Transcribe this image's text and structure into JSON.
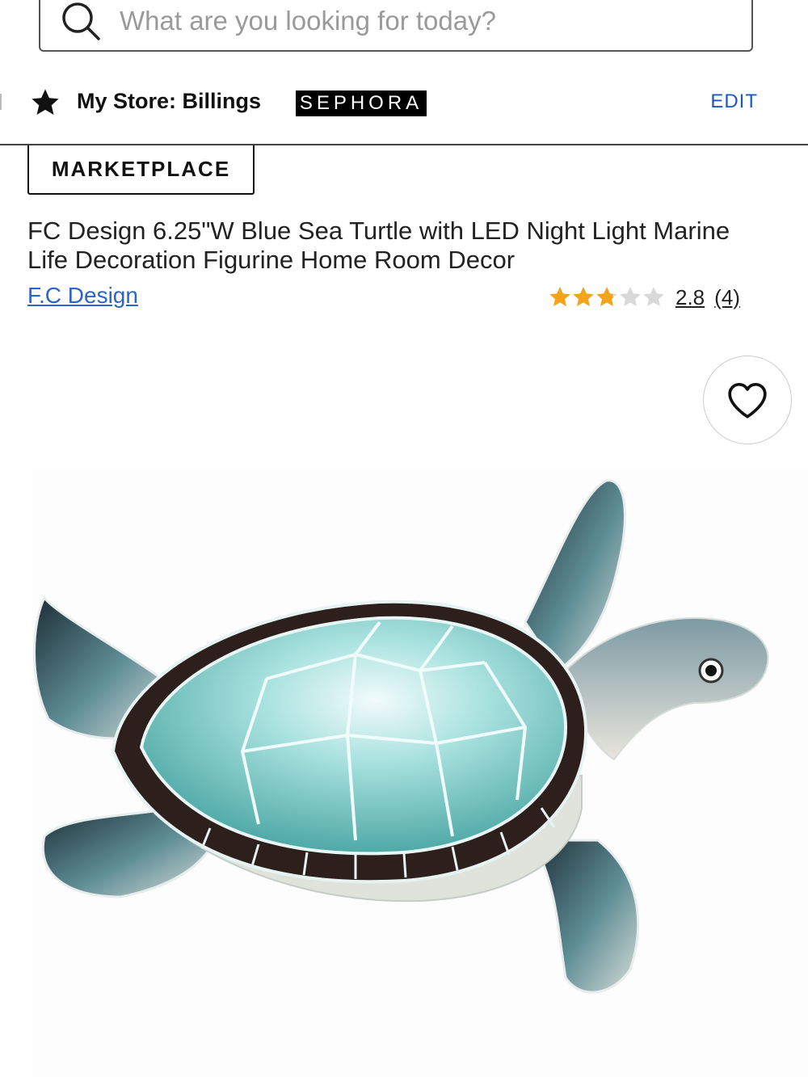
{
  "search": {
    "placeholder": "What are you looking for today?",
    "value": ""
  },
  "store": {
    "label": "My Store: Billings",
    "brand_badge": "SEPHORA",
    "edit_label": "EDIT"
  },
  "product": {
    "tag": "MARKETPLACE",
    "title": "FC Design 6.25\"W Blue Sea Turtle with LED Night Light Marine Life Decoration Figurine Home Room Decor",
    "brand": "F.C Design",
    "rating": {
      "score": "2.8",
      "count": "(4)",
      "stars_filled": 2.8,
      "stars_total": 5
    },
    "image": "blue-sea-turtle-figurine"
  },
  "icons": {
    "search": "search-icon",
    "store": "star-icon",
    "favorite": "heart-icon"
  },
  "colors": {
    "link": "#2a65c9",
    "edit": "#1a57c7",
    "star": "#f2a51a",
    "star_empty": "#d9d9d9"
  }
}
